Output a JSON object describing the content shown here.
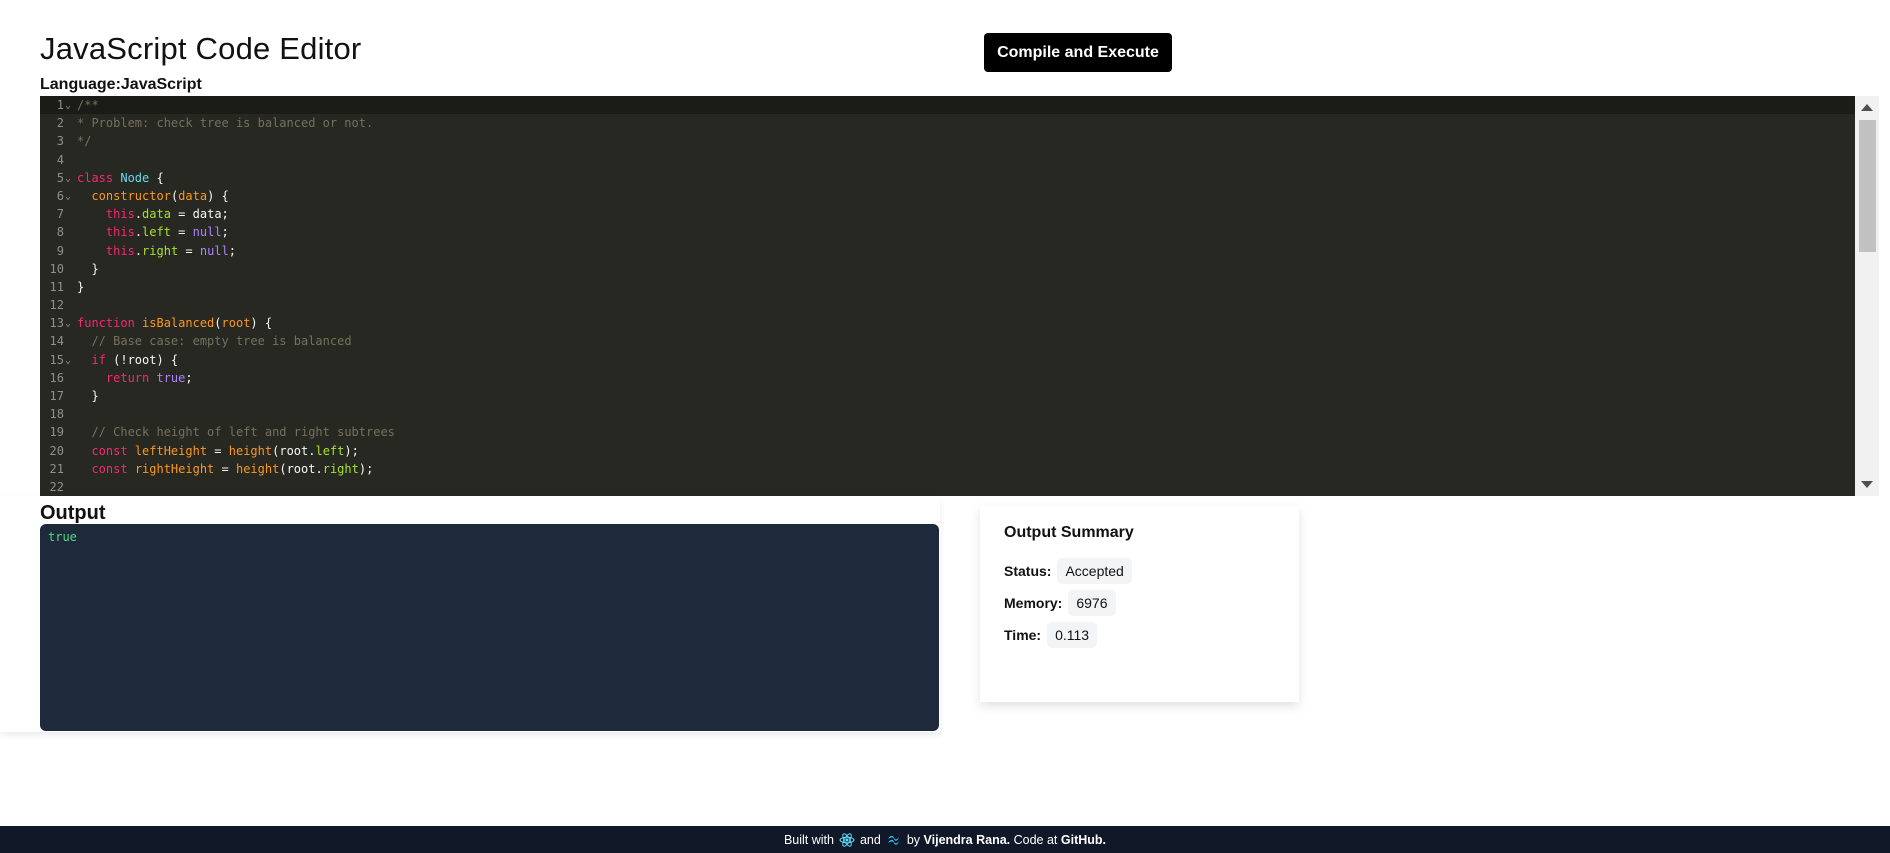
{
  "header": {
    "title": "JavaScript Code Editor",
    "language_label": "Language:",
    "language_value": "JavaScript",
    "run_button": "Compile and Execute"
  },
  "editor": {
    "lines": [
      {
        "n": "1",
        "fold": true,
        "tokens": [
          [
            "cm",
            "/**"
          ]
        ]
      },
      {
        "n": "2",
        "tokens": [
          [
            "cm",
            "* Problem: check tree is balanced or not."
          ]
        ]
      },
      {
        "n": "3",
        "tokens": [
          [
            "cm",
            "*/"
          ]
        ]
      },
      {
        "n": "4",
        "tokens": []
      },
      {
        "n": "5",
        "fold": true,
        "tokens": [
          [
            "kw",
            "class "
          ],
          [
            "cl",
            "Node"
          ],
          [
            "tx",
            " {"
          ]
        ]
      },
      {
        "n": "6",
        "fold": true,
        "tokens": [
          [
            "tx",
            "  "
          ],
          [
            "fn",
            "constructor"
          ],
          [
            "tx",
            "("
          ],
          [
            "pa",
            "data"
          ],
          [
            "tx",
            ") {"
          ]
        ]
      },
      {
        "n": "7",
        "tokens": [
          [
            "tx",
            "    "
          ],
          [
            "kw",
            "this"
          ],
          [
            "tx",
            "."
          ],
          [
            "pr",
            "data"
          ],
          [
            "tx",
            " = "
          ],
          [
            "tx",
            "data"
          ],
          [
            "tx",
            ";"
          ]
        ]
      },
      {
        "n": "8",
        "tokens": [
          [
            "tx",
            "    "
          ],
          [
            "kw",
            "this"
          ],
          [
            "tx",
            "."
          ],
          [
            "pr",
            "left"
          ],
          [
            "tx",
            " = "
          ],
          [
            "nu",
            "null"
          ],
          [
            "tx",
            ";"
          ]
        ]
      },
      {
        "n": "9",
        "tokens": [
          [
            "tx",
            "    "
          ],
          [
            "kw",
            "this"
          ],
          [
            "tx",
            "."
          ],
          [
            "pr",
            "right"
          ],
          [
            "tx",
            " = "
          ],
          [
            "nu",
            "null"
          ],
          [
            "tx",
            ";"
          ]
        ]
      },
      {
        "n": "10",
        "tokens": [
          [
            "tx",
            "  }"
          ]
        ]
      },
      {
        "n": "11",
        "tokens": [
          [
            "tx",
            "}"
          ]
        ]
      },
      {
        "n": "12",
        "tokens": []
      },
      {
        "n": "13",
        "fold": true,
        "tokens": [
          [
            "kw",
            "function "
          ],
          [
            "fn",
            "isBalanced"
          ],
          [
            "tx",
            "("
          ],
          [
            "pa",
            "root"
          ],
          [
            "tx",
            ") {"
          ]
        ]
      },
      {
        "n": "14",
        "tokens": [
          [
            "tx",
            "  "
          ],
          [
            "cm",
            "// Base case: empty tree is balanced"
          ]
        ]
      },
      {
        "n": "15",
        "fold": true,
        "tokens": [
          [
            "tx",
            "  "
          ],
          [
            "kw",
            "if"
          ],
          [
            "tx",
            " (!root) {"
          ]
        ]
      },
      {
        "n": "16",
        "tokens": [
          [
            "tx",
            "    "
          ],
          [
            "kw",
            "return "
          ],
          [
            "nu",
            "true"
          ],
          [
            "tx",
            ";"
          ]
        ]
      },
      {
        "n": "17",
        "tokens": [
          [
            "tx",
            "  }"
          ]
        ]
      },
      {
        "n": "18",
        "tokens": []
      },
      {
        "n": "19",
        "tokens": [
          [
            "tx",
            "  "
          ],
          [
            "cm",
            "// Check height of left and right subtrees"
          ]
        ]
      },
      {
        "n": "20",
        "tokens": [
          [
            "tx",
            "  "
          ],
          [
            "kw",
            "const "
          ],
          [
            "fn",
            "leftHeight"
          ],
          [
            "tx",
            " = "
          ],
          [
            "fn",
            "height"
          ],
          [
            "tx",
            "("
          ],
          [
            "tx",
            "root"
          ],
          [
            "tx",
            "."
          ],
          [
            "pr",
            "left"
          ],
          [
            "tx",
            ");"
          ]
        ]
      },
      {
        "n": "21",
        "tokens": [
          [
            "tx",
            "  "
          ],
          [
            "kw",
            "const "
          ],
          [
            "fn",
            "rightHeight"
          ],
          [
            "tx",
            " = "
          ],
          [
            "fn",
            "height"
          ],
          [
            "tx",
            "("
          ],
          [
            "tx",
            "root"
          ],
          [
            "tx",
            "."
          ],
          [
            "pr",
            "right"
          ],
          [
            "tx",
            ");"
          ]
        ]
      },
      {
        "n": "22",
        "tokens": []
      }
    ]
  },
  "output": {
    "heading": "Output",
    "text": "true"
  },
  "summary": {
    "title": "Output Summary",
    "status_label": "Status:",
    "status_value": "Accepted",
    "memory_label": "Memory:",
    "memory_value": "6976",
    "time_label": "Time:",
    "time_value": "0.113"
  },
  "footer": {
    "built_with": "Built with",
    "and": "and",
    "by": "by",
    "author": "Vijendra Rana.",
    "code_at": "Code at",
    "repo": "GitHub.",
    "icons": [
      "react-icon",
      "tailwind-icon"
    ]
  },
  "colors": {
    "editor_bg": "#272822",
    "output_bg": "#1e293b",
    "output_text": "#4ade80",
    "footer_bg": "#111827",
    "button_bg": "#000000"
  }
}
